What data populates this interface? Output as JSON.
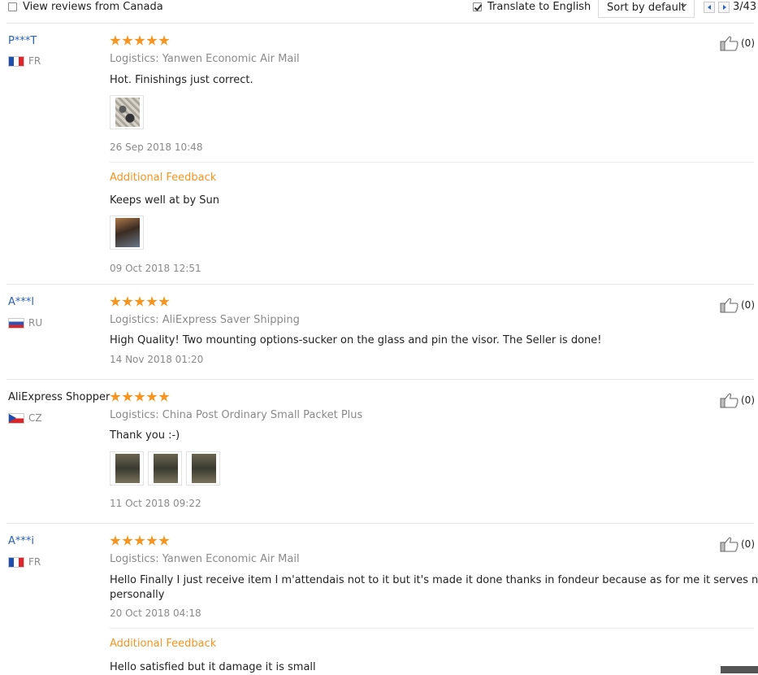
{
  "filters": {
    "view_canada_label": "View reviews from Canada",
    "view_canada_checked": false,
    "translate_label": "Translate to English",
    "translate_checked": true,
    "sort_label": "Sort by default",
    "page_indicator": "3/43"
  },
  "reviews": [
    {
      "user": "P***T",
      "country": "FR",
      "rating": 5,
      "logistics": "Logistics: Yanwen Economic Air Mail",
      "text": "Hot. Finishings just correct.",
      "date": "26 Sep 2018 10:48",
      "additional_label": "Additional Feedback",
      "additional_text": "Keeps well at by Sun",
      "additional_date": "09 Oct 2018 12:51",
      "likes": "(0)"
    },
    {
      "user": "A***l",
      "country": "RU",
      "rating": 5,
      "logistics": "Logistics: AliExpress Saver Shipping",
      "text": "High Quality! Two mounting options-sucker on the glass and pin the visor. The Seller is done!",
      "date": "14 Nov 2018 01:20",
      "likes": "(0)"
    },
    {
      "user": "AliExpress Shopper",
      "country": "CZ",
      "rating": 5,
      "logistics": "Logistics: China Post Ordinary Small Packet Plus",
      "text": "Thank you :-)",
      "date": "11 Oct 2018 09:22",
      "likes": "(0)"
    },
    {
      "user": "A***i",
      "country": "FR",
      "rating": 5,
      "logistics": "Logistics: Yanwen Economic Air Mail",
      "text_line1": "Hello Finally I just receive item I m'attendais not to it but it's made it done thanks in fondeur because as for me it serves nothing",
      "text_line2": "personally",
      "date": "20 Oct 2018 04:18",
      "additional_label": "Additional Feedback",
      "additional_text": "Hello satisfied but it damage it is small",
      "likes": "(0)"
    }
  ],
  "icons": {
    "like": "thumbs-up-icon",
    "star": "star-icon",
    "prev": "arrow-left-icon",
    "next": "arrow-right-icon"
  },
  "colors": {
    "accent_orange": "#f7941e",
    "link_blue": "#2a62b7",
    "muted_gray": "#8a8a8a"
  }
}
